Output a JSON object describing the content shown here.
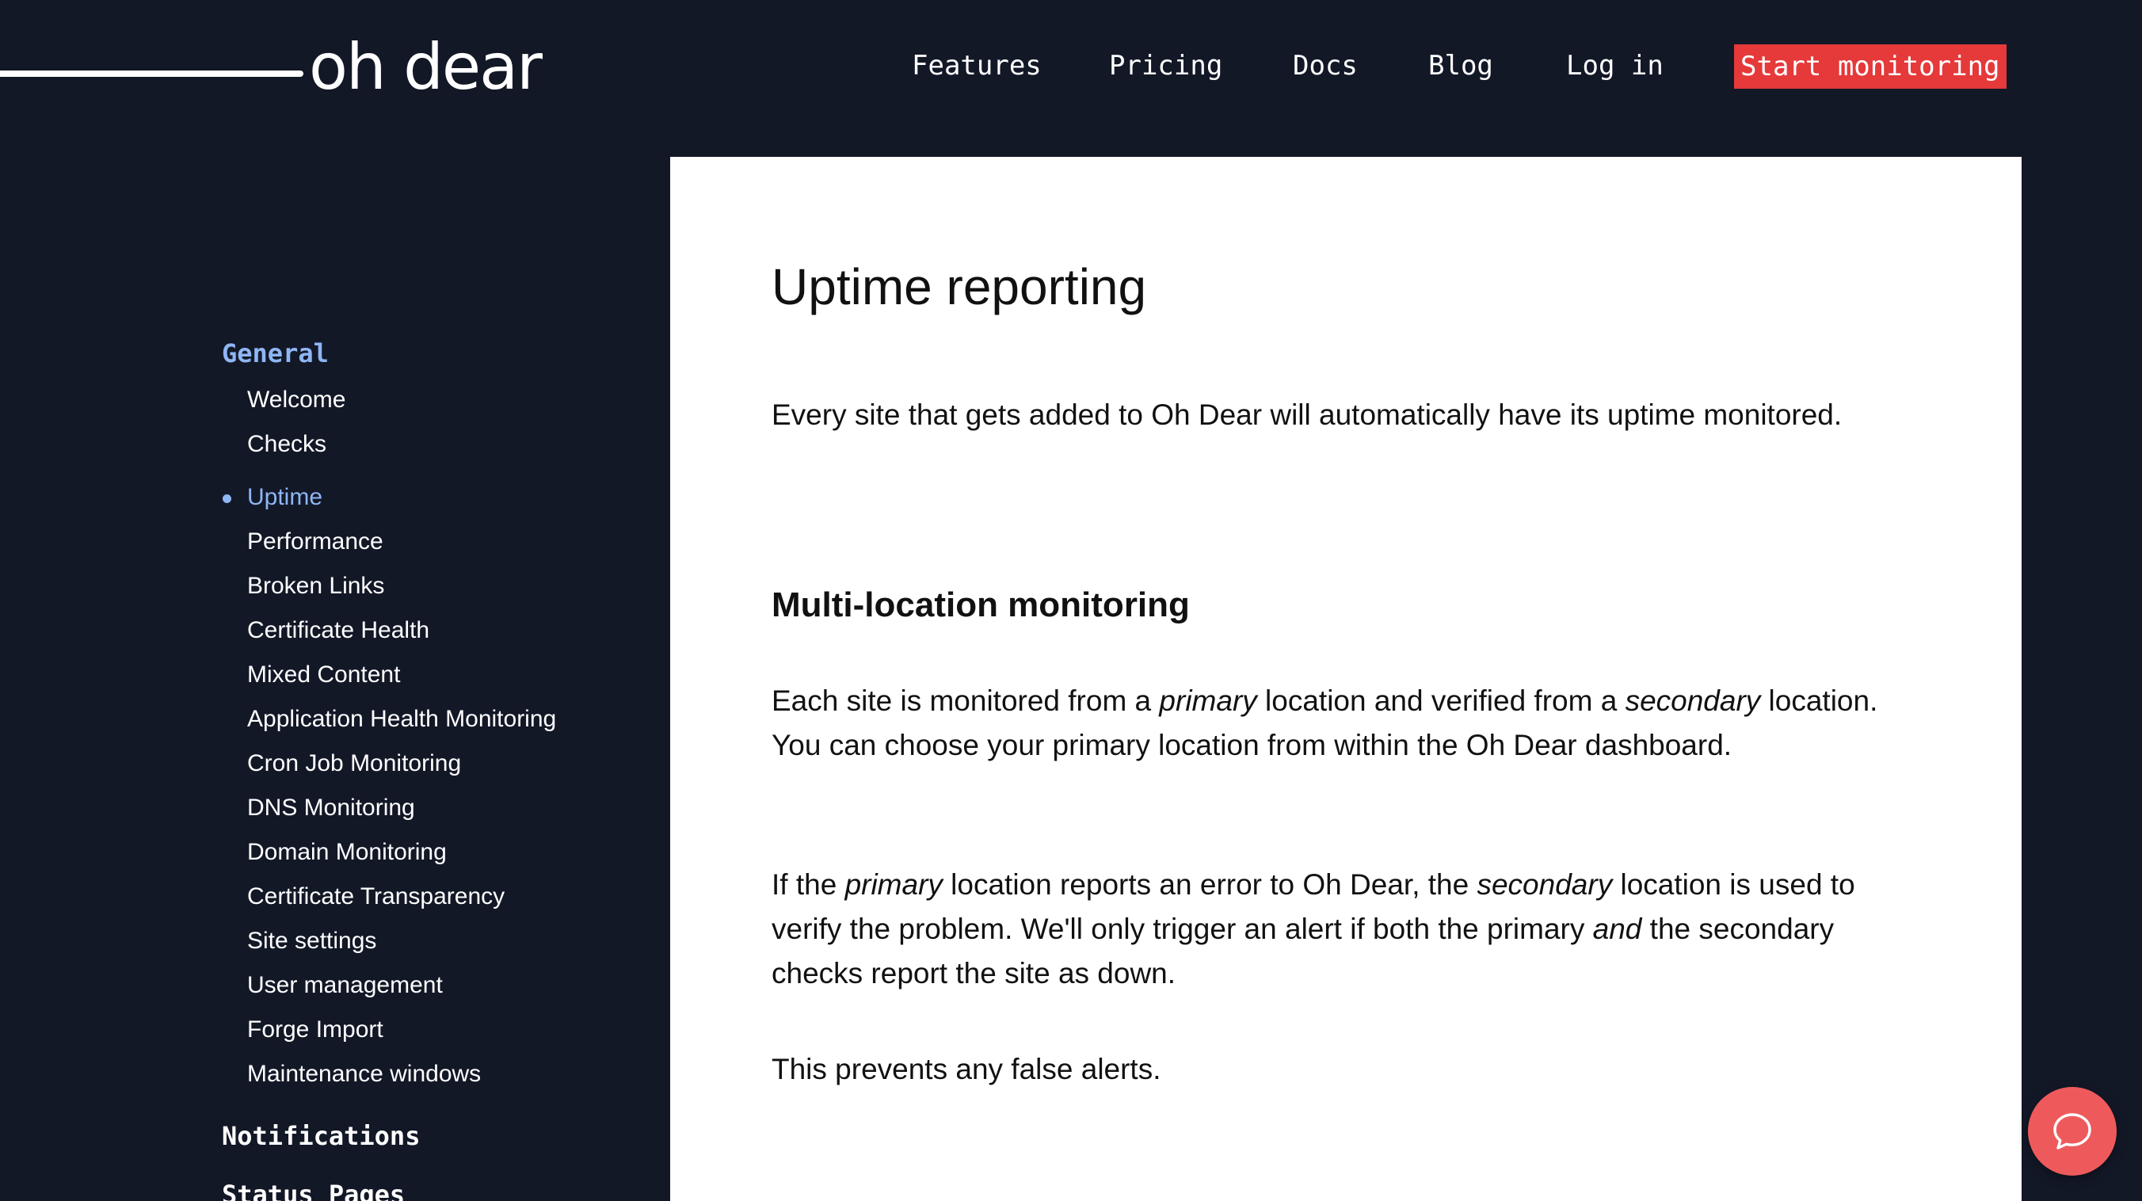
{
  "brand": {
    "logo_text": "oh dear"
  },
  "nav": {
    "features": "Features",
    "pricing": "Pricing",
    "docs": "Docs",
    "blog": "Blog",
    "login": "Log in",
    "cta": "Start monitoring"
  },
  "sidebar": {
    "general_title": "General",
    "items": [
      "Welcome",
      "Checks",
      "Uptime",
      "Performance",
      "Broken Links",
      "Certificate Health",
      "Mixed Content",
      "Application Health Monitoring",
      "Cron Job Monitoring",
      "DNS Monitoring",
      "Domain Monitoring",
      "Certificate Transparency",
      "Site settings",
      "User management",
      "Forge Import",
      "Maintenance windows"
    ],
    "current_item": "Uptime",
    "notifications_title": "Notifications",
    "status_pages_title": "Status Pages"
  },
  "content": {
    "title": "Uptime reporting",
    "intro": "Every site that gets added to Oh Dear will automatically have its uptime monitored.",
    "multi_location_heading": "Multi-location monitoring",
    "p1_a": "Each site is monitored from a ",
    "p1_em1": "primary",
    "p1_b": " location and verified from a ",
    "p1_em2": "secondary",
    "p1_c": " location. You can choose your primary location from within the Oh Dear dashboard.",
    "p2_a": "If the ",
    "p2_em1": "primary",
    "p2_b": " location reports an error to Oh Dear, the ",
    "p2_em2": "secondary",
    "p2_c": " location is used to verify the problem. We'll only trigger an alert if both the primary ",
    "p2_em3": "and",
    "p2_d": " the secondary checks report the site as down.",
    "p3": "This prevents any false alerts."
  },
  "colors": {
    "background": "#131827",
    "accent_red": "#e5393a",
    "sidebar_active": "#8eb6f4",
    "chat_button": "#ee5a5b"
  },
  "icons": {
    "chat": "chat-bubble-icon"
  }
}
